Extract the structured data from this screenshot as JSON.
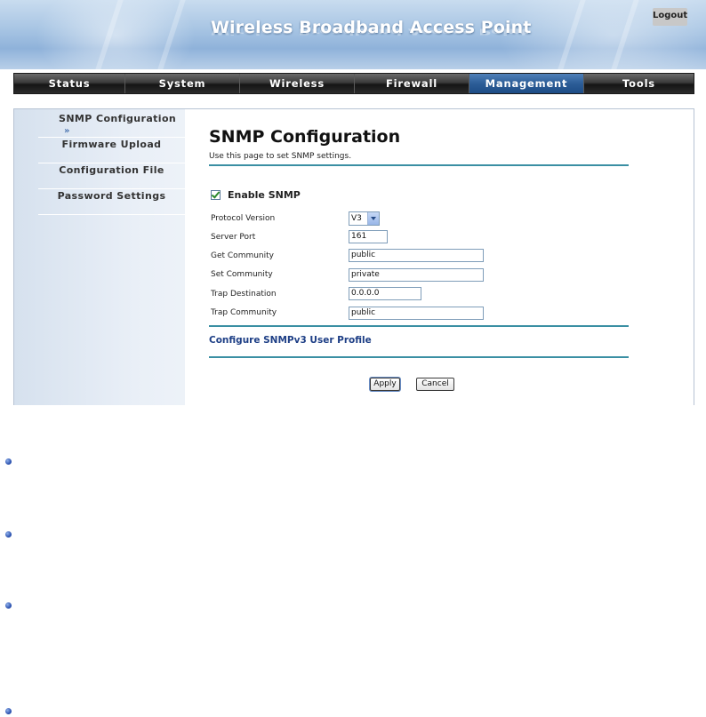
{
  "header": {
    "title": "Wireless Broadband Access Point",
    "logout_label": "Logout"
  },
  "nav": {
    "tabs": [
      {
        "label": "Status"
      },
      {
        "label": "System"
      },
      {
        "label": "Wireless"
      },
      {
        "label": "Firewall"
      },
      {
        "label": "Management",
        "active": true
      },
      {
        "label": "Tools"
      }
    ]
  },
  "sidebar": {
    "items": [
      {
        "label": "SNMP Configuration",
        "active": true,
        "arrow": "»"
      },
      {
        "label": "Firmware Upload"
      },
      {
        "label": "Configuration File"
      },
      {
        "label": "Password Settings"
      }
    ]
  },
  "main": {
    "title": "SNMP Configuration",
    "description": "Use this page to set SNMP settings.",
    "enable_label": "Enable SNMP",
    "enable_checked": true,
    "fields": {
      "protocol_version": {
        "label": "Protocol Version",
        "value": "V3"
      },
      "server_port": {
        "label": "Server Port",
        "value": "161"
      },
      "get_community": {
        "label": "Get Community",
        "value": "public"
      },
      "set_community": {
        "label": "Set Community",
        "value": "private"
      },
      "trap_destination": {
        "label": "Trap Destination",
        "value": "0.0.0.0"
      },
      "trap_community": {
        "label": "Trap Community",
        "value": "public"
      }
    },
    "snmpv3_link": "Configure SNMPv3 User Profile",
    "apply_label": "Apply",
    "cancel_label": "Cancel"
  },
  "colors": {
    "nav_active": "#2c5d97",
    "rule": "#3a8fa3",
    "link": "#1e3f86",
    "bullet": "#1f46a8"
  }
}
